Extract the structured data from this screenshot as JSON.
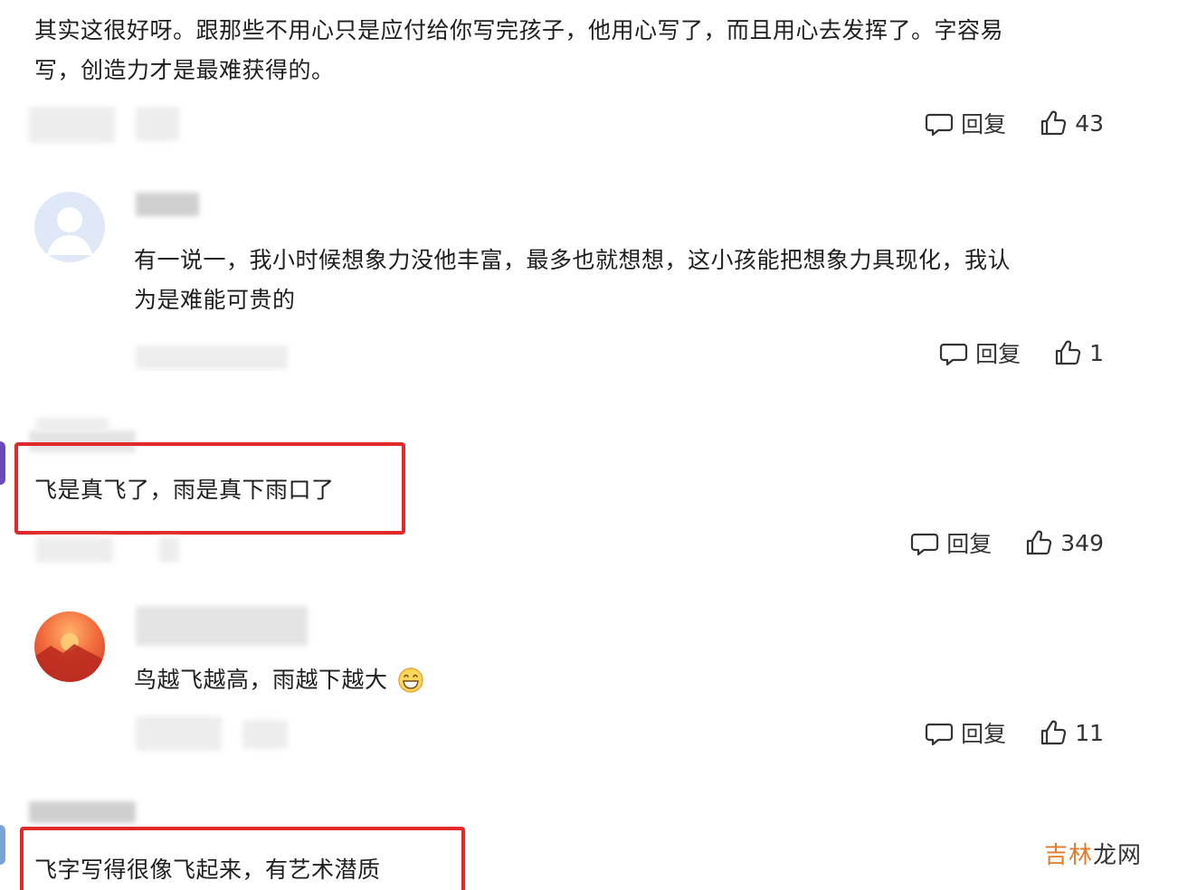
{
  "comments": [
    {
      "text_line1": "其实这很好呀。跟那些不用心只是应付给你写完孩子，他用心写了，而且用心去发挥了。字容易",
      "text_line2": "写，创造力才是最难获得的。",
      "reply_label": "回复",
      "likes": "43"
    },
    {
      "text_line1": "有一说一，我小时候想象力没他丰富，最多也就想想，这小孩能把想象力具现化，我认",
      "text_line2": "为是难能可贵的",
      "reply_label": "回复",
      "likes": "1"
    },
    {
      "text_line1": "飞是真飞了，雨是真下雨口了",
      "reply_label": "回复",
      "likes": "349"
    },
    {
      "text_line1": "鸟越飞越高，雨越下越大",
      "reply_label": "回复",
      "likes": "11"
    },
    {
      "text_line1": "飞字写得很像飞起来，有艺术潜质"
    }
  ],
  "watermark": {
    "part1": "吉林",
    "part2": "龙网"
  },
  "colors": {
    "highlight_box": "#e2292a",
    "watermark": "#e07b2b"
  },
  "icons": {
    "reply": "comment-bubble-icon",
    "like": "thumbs-up-icon",
    "emoji": "grin-emoji-icon"
  }
}
